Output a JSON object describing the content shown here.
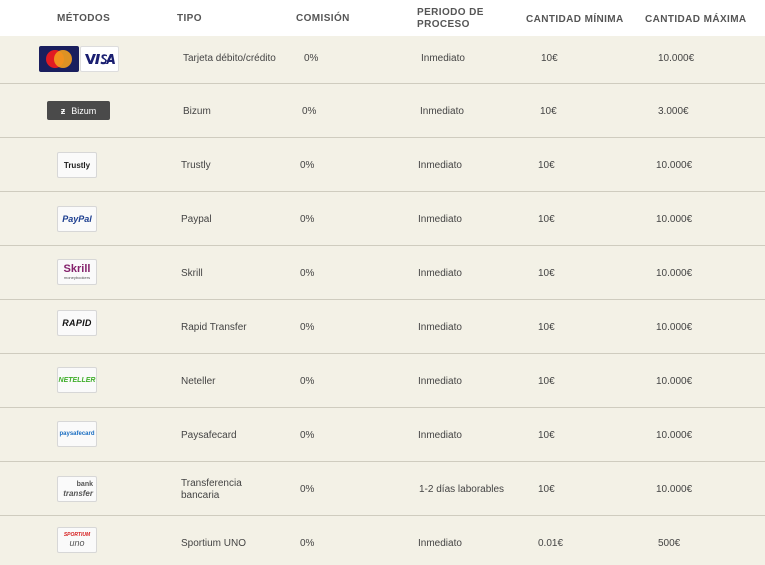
{
  "header": {
    "metodos": "MÉTODOS",
    "tipo": "TIPO",
    "comision": "COMISIÓN",
    "periodo_line1": "PERIODO DE",
    "periodo_line2": "PROCESO",
    "minima": "CANTIDAD MÍNIMA",
    "maxima": "CANTIDAD MÁXIMA"
  },
  "rows": [
    {
      "logo": "mastercard-visa-logo",
      "tipo": "Tarjeta débito/crédito",
      "comision": "0%",
      "periodo": "Inmediato",
      "min": "10€",
      "max": "10.000€"
    },
    {
      "logo": "bizum-logo",
      "tipo": "Bizum",
      "comision": "0%",
      "periodo": "Inmediato",
      "min": "10€",
      "max": "3.000€",
      "logo_text": "Bizum"
    },
    {
      "logo": "trustly-logo",
      "tipo": "Trustly",
      "comision": "0%",
      "periodo": "Inmediato",
      "min": "10€",
      "max": "10.000€",
      "logo_text": "Trustly"
    },
    {
      "logo": "paypal-logo",
      "tipo": "Paypal",
      "comision": "0%",
      "periodo": "Inmediato",
      "min": "10€",
      "max": "10.000€",
      "logo_text": "PayPal"
    },
    {
      "logo": "skrill-logo",
      "tipo": "Skrill",
      "comision": "0%",
      "periodo": "Inmediato",
      "min": "10€",
      "max": "10.000€",
      "logo_text": "Skrill",
      "logo_sub": "moneybookers"
    },
    {
      "logo": "rapid-logo",
      "tipo": "Rapid Transfer",
      "comision": "0%",
      "periodo": "Inmediato",
      "min": "10€",
      "max": "10.000€",
      "logo_text": "RAPID"
    },
    {
      "logo": "neteller-logo",
      "tipo": "Neteller",
      "comision": "0%",
      "periodo": "Inmediato",
      "min": "10€",
      "max": "10.000€",
      "logo_text": "NETELLER"
    },
    {
      "logo": "paysafecard-logo",
      "tipo": "Paysafecard",
      "comision": "0%",
      "periodo": "Inmediato",
      "min": "10€",
      "max": "10.000€",
      "logo_text": "paysafecard"
    },
    {
      "logo": "bank-transfer-logo",
      "tipo_line1": "Transferencia",
      "tipo_line2": "bancaria",
      "comision": "0%",
      "periodo": "1-2 días laborables",
      "min": "10€",
      "max": "10.000€",
      "logo_text1": "bank",
      "logo_text2": "transfer"
    },
    {
      "logo": "sportium-uno-logo",
      "tipo": "Sportium UNO",
      "comision": "0%",
      "periodo": "Inmediato",
      "min": "0.01€",
      "max": "500€",
      "logo_text1": "SPORTIUM",
      "logo_text2": "uno"
    }
  ],
  "colors": {
    "row_bg": "#f3f1e6",
    "divider": "#cfccbf",
    "bizum": "#4a4a4a",
    "trustly": "#1fa83a",
    "paypal": "#1b3d8f",
    "skrill": "#84216b",
    "neteller": "#3fae2a",
    "paysafecard": "#1b6ec2",
    "sportium": "#d62020"
  }
}
